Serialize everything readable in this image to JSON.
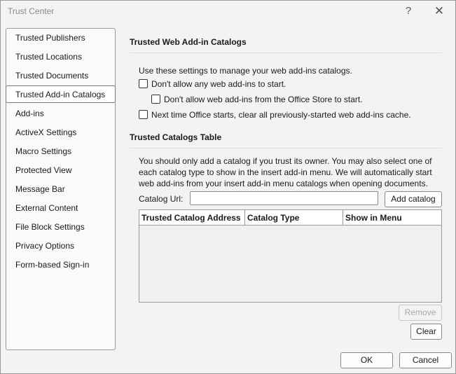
{
  "window": {
    "title": "Trust Center",
    "help_glyph": "?",
    "close_glyph": "✕"
  },
  "sidebar": {
    "items": [
      {
        "label": "Trusted Publishers"
      },
      {
        "label": "Trusted Locations"
      },
      {
        "label": "Trusted Documents"
      },
      {
        "label": "Trusted Add-in Catalogs",
        "selected": true
      },
      {
        "label": "Add-ins"
      },
      {
        "label": "ActiveX Settings"
      },
      {
        "label": "Macro Settings"
      },
      {
        "label": "Protected View"
      },
      {
        "label": "Message Bar"
      },
      {
        "label": "External Content"
      },
      {
        "label": "File Block Settings"
      },
      {
        "label": "Privacy Options"
      },
      {
        "label": "Form-based Sign-in"
      }
    ]
  },
  "web_catalogs": {
    "heading": "Trusted Web Add-in Catalogs",
    "intro": "Use these settings to manage your web add-ins catalogs.",
    "options": [
      {
        "label": "Don't allow any web add-ins to start.",
        "checked": false
      },
      {
        "label": "Don't allow web add-ins from the Office Store to start.",
        "checked": false
      },
      {
        "label": "Next time Office starts, clear all previously-started web add-ins cache.",
        "checked": false
      }
    ]
  },
  "catalogs_table": {
    "heading": "Trusted Catalogs Table",
    "description": "You should only add a catalog if you trust its owner. You may also select one of each catalog type to show in the insert add-in menu. We will automatically start web add-ins from your insert add-in menu catalogs when opening documents.",
    "url_label": "Catalog Url:",
    "url_value": "",
    "add_button": "Add catalog",
    "columns": [
      "Trusted Catalog Address",
      "Catalog Type",
      "Show in Menu"
    ],
    "rows": [],
    "remove_button": "Remove",
    "clear_button": "Clear"
  },
  "footer": {
    "ok_button": "OK",
    "cancel_button": "Cancel"
  }
}
